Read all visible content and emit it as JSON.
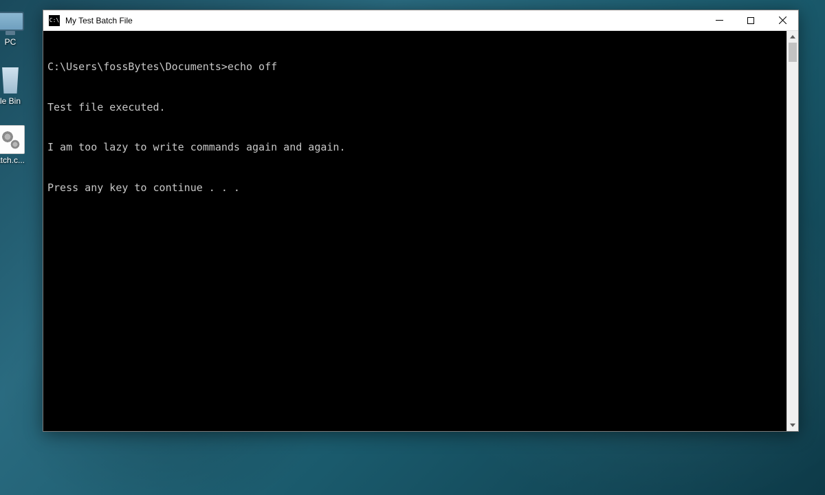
{
  "desktop": {
    "icons": [
      {
        "name": "this-pc",
        "label": "PC"
      },
      {
        "name": "recycle-bin",
        "label": "le Bin"
      },
      {
        "name": "batch-file",
        "label": "atch.c..."
      }
    ]
  },
  "window": {
    "title": "My Test Batch File",
    "app_icon_text": "C:\\",
    "console_lines": [
      "C:\\Users\\fossBytes\\Documents>echo off",
      "Test file executed.",
      "I am too lazy to write commands again and again.",
      "Press any key to continue . . ."
    ]
  }
}
